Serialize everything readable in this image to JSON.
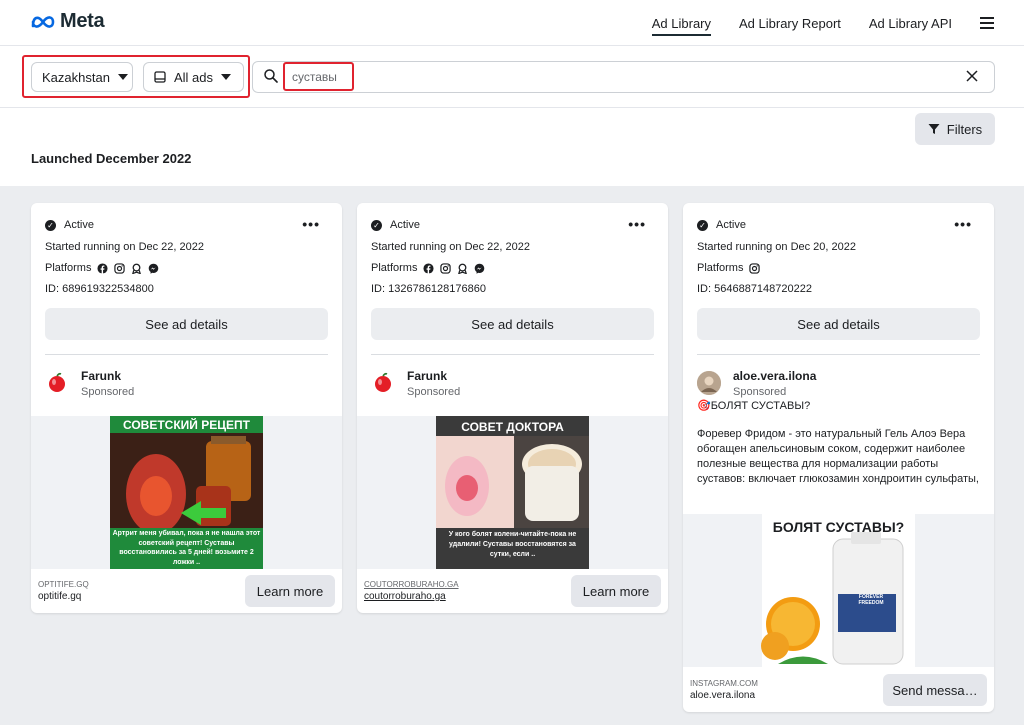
{
  "header": {
    "logo_text": "Meta",
    "nav": [
      "Ad Library",
      "Ad Library Report",
      "Ad Library API"
    ]
  },
  "filters": {
    "country": "Kazakhstan",
    "ad_type": "All ads",
    "search_value": "суставы",
    "filters_label": "Filters"
  },
  "section_title": "Launched December 2022",
  "cards": [
    {
      "status": "Active",
      "started": "Started running on Dec 22, 2022",
      "platforms_label": "Platforms",
      "platforms": [
        "facebook-icon",
        "instagram-icon",
        "audience-network-icon",
        "messenger-icon"
      ],
      "id": "ID: 689619322534800",
      "see_details": "See ad details",
      "advertiser": "Farunk",
      "sponsored": "Sponsored",
      "creative_banner": "СОВЕТСКИЙ РЕЦЕПТ",
      "creative_caption": "Артрит меня убивал, пока я не нашла этот советский рецепт! Суставы восстановились за 5 дней! возьмите 2 ложки ..",
      "footer_domain": "OPTITIFE.GQ",
      "footer_name": "optitife.gq",
      "cta": "Learn more"
    },
    {
      "status": "Active",
      "started": "Started running on Dec 22, 2022",
      "platforms_label": "Platforms",
      "platforms": [
        "facebook-icon",
        "instagram-icon",
        "audience-network-icon",
        "messenger-icon"
      ],
      "id": "ID: 1326786128176860",
      "see_details": "See ad details",
      "advertiser": "Farunk",
      "sponsored": "Sponsored",
      "creative_banner": "СОВЕТ ДОКТОРА",
      "creative_caption": "У кого болят колени-читайте-пока не удалили! Суставы восстановятся за сутки, если ..",
      "footer_domain": "COUTORROBURAHO.GA",
      "footer_name": "coutorroburaho.ga",
      "cta": "Learn more"
    },
    {
      "status": "Active",
      "started": "Started running on Dec 20, 2022",
      "platforms_label": "Platforms",
      "platforms": [
        "instagram-icon"
      ],
      "id": "ID: 5646887148720222",
      "see_details": "See ad details",
      "advertiser": "aloe.vera.ilona",
      "sponsored": "Sponsored",
      "ad_headline": "🎯БОЛЯТ СУСТАВЫ?",
      "ad_body": "Форевер Фридом - это натуральный Гель Алоэ Вера обогащен апельсиновым соком, содержит наиболее полезные вещества для нормализации работы суставов: включает глюкозамин хондроитин сульфаты, метилсульфонилметан (МСМ), а также питательные…",
      "creative_banner": "БОЛЯТ СУСТАВЫ?",
      "product_label": "FOREVER FREEDOM",
      "footer_domain": "INSTAGRAM.COM",
      "footer_name": "aloe.vera.ilona",
      "cta": "Send messa…"
    }
  ],
  "colors": {
    "highlight": "#e0232f",
    "meta_blue": "#0668e1",
    "green_banner": "#1f8a3b",
    "gray_banner": "#3a3a3a"
  }
}
